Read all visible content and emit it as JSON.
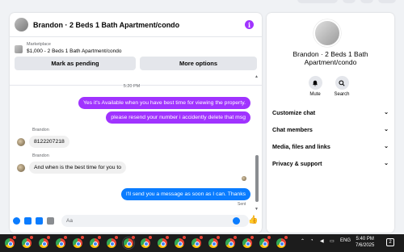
{
  "colors": {
    "accent_purple": "#a033ff",
    "accent_blue": "#0a7cff",
    "incoming_bubble": "#f0f0f0",
    "panel_bg": "#ffffff",
    "page_bg": "#f0f2f5",
    "taskbar": "#1c1c1c"
  },
  "chat": {
    "title": "Brandon · 2 Beds 1 Bath Apartment/condo",
    "info_icon": "info-icon",
    "marketplace": {
      "label": "Marketplace",
      "item": "$1,000 - 2 Beds 1 Bath Apartment/condo",
      "mark_pending_label": "Mark as pending",
      "more_options_label": "More options"
    },
    "timestamp": "5:20 PM",
    "messages": [
      {
        "from": "me",
        "text": "Yes it's Available when you have best time for viewing the property."
      },
      {
        "from": "me",
        "text": "please resend your number i accidently delete that msg"
      },
      {
        "from": "Brandon",
        "sender_label": "Brandon",
        "text": "8122207218"
      },
      {
        "from": "Brandon",
        "sender_label": "Brandon",
        "text": "And when is the best time for you to"
      },
      {
        "from": "me",
        "text": "I'll send you a message as soon as I can. Thanks"
      }
    ],
    "sent_label": "Sent",
    "composer": {
      "placeholder": "Aa",
      "icons": [
        "plus-icon",
        "image-icon",
        "sticker-icon",
        "gif-icon",
        "emoji-icon",
        "like-icon"
      ]
    }
  },
  "details": {
    "title": "Brandon · 2 Beds 1 Bath Apartment/condo",
    "actions": [
      {
        "label": "Mute",
        "icon": "bell-icon"
      },
      {
        "label": "Search",
        "icon": "search-icon"
      }
    ],
    "sections": [
      {
        "label": "Customize chat"
      },
      {
        "label": "Chat members"
      },
      {
        "label": "Media, files and links"
      },
      {
        "label": "Privacy & support"
      }
    ]
  },
  "taskbar": {
    "app_count": 17,
    "tray": {
      "language": "ENG",
      "time": "5:40 PM",
      "date": "7/6/2025",
      "notifications": "2"
    }
  }
}
